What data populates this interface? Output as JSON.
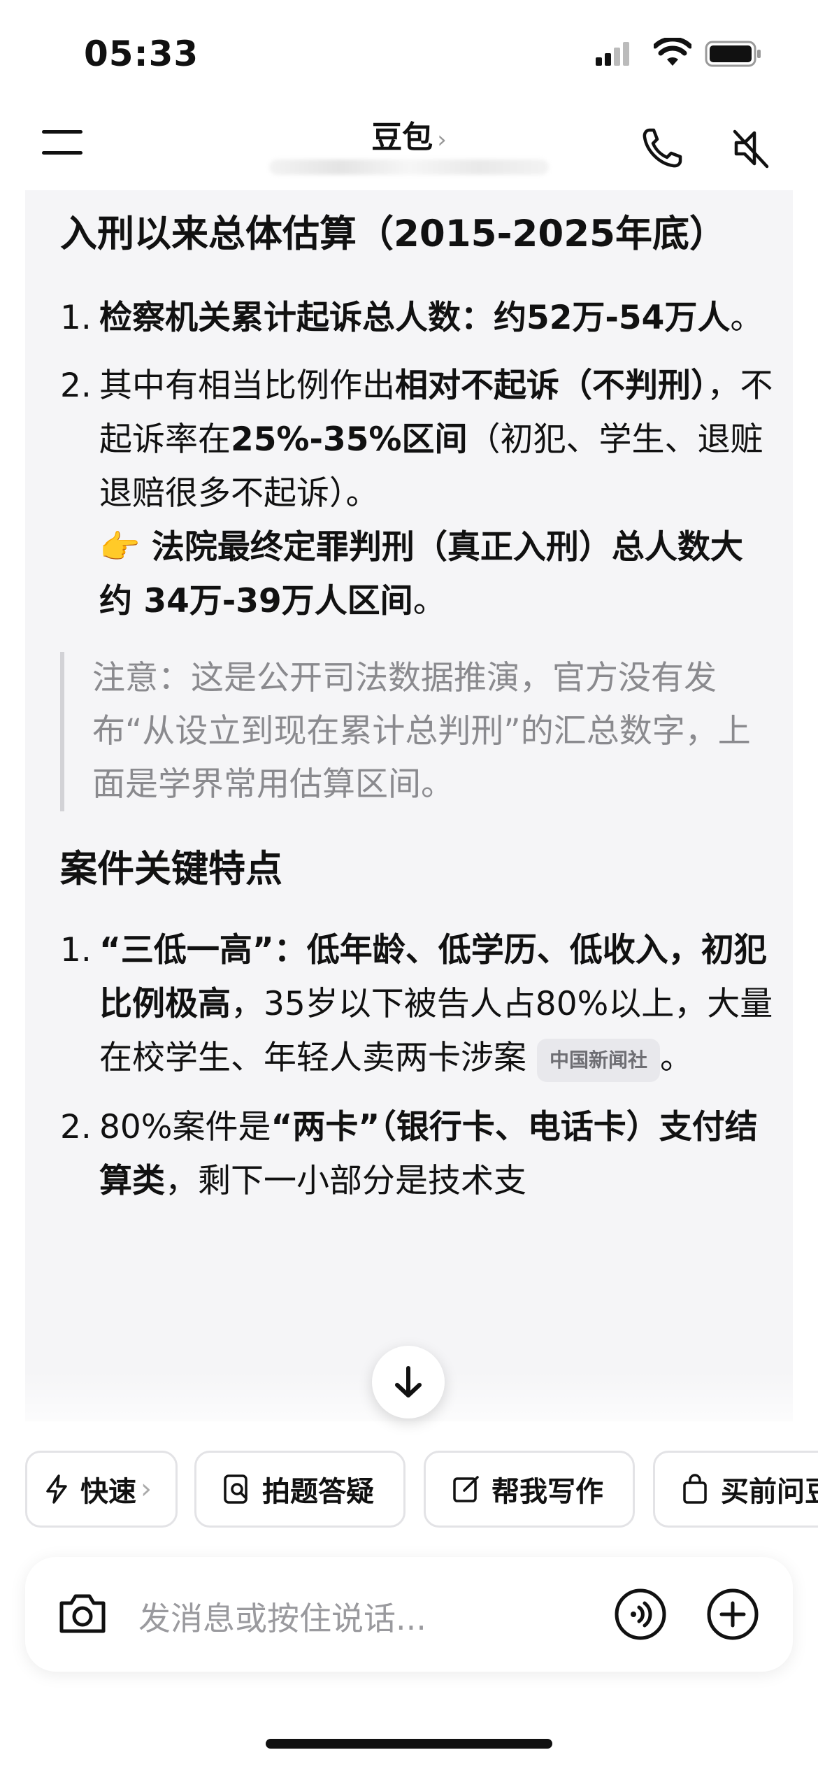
{
  "status": {
    "time": "05:33"
  },
  "header": {
    "title": "豆包",
    "title_chevron": "›"
  },
  "message": {
    "heading1": "入刑以来总体估算（2015-2025年底）",
    "list1": {
      "item1": {
        "num": "1.",
        "bold": "检察机关累计起诉总人数：约52万-54万人",
        "tail": "。"
      },
      "item2": {
        "num": "2.",
        "t1": "其中有相当比例作出",
        "b1": "相对不起诉（不判刑）",
        "t2": "，不起诉率在",
        "b2": "25%-35%区间",
        "t3": "（初犯、学生、退赃退赔很多不起诉）。",
        "emoji": "👉",
        "b3": " 法院最终定罪判刑（真正入刑）总人数大约 34万-39万人区间",
        "t4": "。"
      }
    },
    "note": "注意：这是公开司法数据推演，官方没有发布“从设立到现在累计总判刑”的汇总数字，上面是学界常用估算区间。",
    "heading2": "案件关键特点",
    "list2": {
      "item1": {
        "num": "1.",
        "b1": "“三低一高”：低年龄、低学历、低收入，初犯比例极高",
        "t1": "，35岁以下被告人占80%以上，大量在校学生、年轻人卖两卡涉案",
        "tag": "中国新闻社",
        "t2": "。"
      },
      "item2": {
        "num": "2.",
        "t1": "80%案件是",
        "b1": "“两卡”（银行卡、电话卡）支付结算类",
        "t2": "，剩下一小部分是技术支"
      }
    }
  },
  "quick_actions": [
    {
      "label": "快速",
      "icon": "lightning-icon",
      "suffix": "›"
    },
    {
      "label": "拍题答疑",
      "icon": "photo-question-icon"
    },
    {
      "label": "帮我写作",
      "icon": "edit-icon"
    },
    {
      "label": "买前问豆",
      "icon": "shopping-bag-icon"
    }
  ],
  "composer": {
    "placeholder": "发消息或按住说话..."
  }
}
